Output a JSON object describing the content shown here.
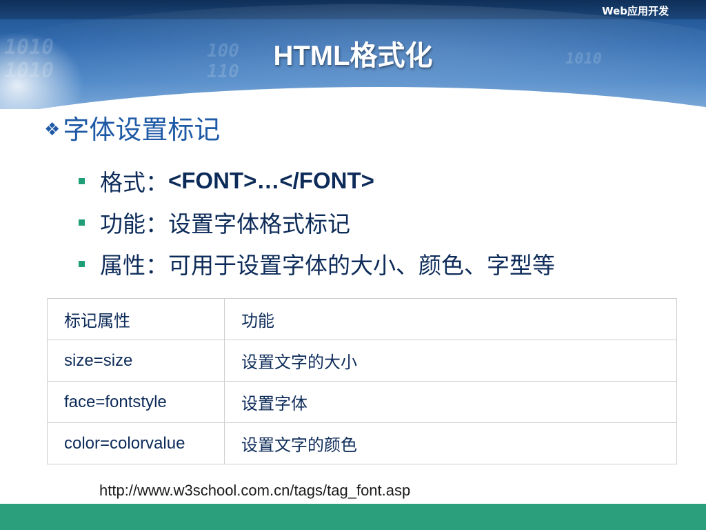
{
  "header": {
    "subject": "Web应用开发",
    "title": "HTML格式化"
  },
  "section": {
    "heading": "字体设置标记",
    "bullets": [
      {
        "label": "格式：",
        "value": "<FONT>…</FONT>"
      },
      {
        "label": "功能：",
        "value": "设置字体格式标记"
      },
      {
        "label": "属性：",
        "value": "可用于设置字体的大小、颜色、字型等"
      }
    ]
  },
  "table": {
    "headers": [
      "标记属性",
      "功能"
    ],
    "rows": [
      [
        "size=size",
        "设置文字的大小"
      ],
      [
        "face=fontstyle",
        "设置字体"
      ],
      [
        "color=colorvalue",
        "设置文字的颜色"
      ]
    ]
  },
  "reference": {
    "url": "http://www.w3school.com.cn/tags/tag_font.asp"
  },
  "colors": {
    "heading": "#1f5aa6",
    "text": "#0d2b59",
    "bullet": "#1f9e78",
    "footer": "#2b9e7c",
    "banner": "#2f6ab0"
  },
  "icons": {
    "heading_marker": "diamond-bullet-icon",
    "list_marker": "square-bullet-icon"
  }
}
